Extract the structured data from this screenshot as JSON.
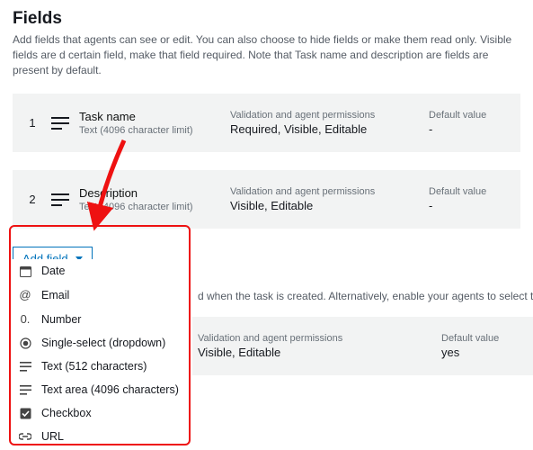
{
  "header": {
    "title": "Fields",
    "help": "Add fields that agents can see or edit. You can also choose to hide fields or make them read only. Visible fields are d certain field, make that field required. Note that Task name and description are fields are present by default."
  },
  "labels": {
    "validation": "Validation and agent permissions",
    "default": "Default value"
  },
  "fields": [
    {
      "num": "1",
      "name": "Task name",
      "sub": "Text (4096 character limit)",
      "validation": "Required, Visible, Editable",
      "default": "-"
    },
    {
      "num": "2",
      "name": "Description",
      "sub": "Text (4096 character limit)",
      "validation": "Visible, Editable",
      "default": "-"
    }
  ],
  "add_field_label": "Add field",
  "dropdown": [
    {
      "icon": "calendar",
      "label": "Date"
    },
    {
      "icon": "at",
      "label": "Email"
    },
    {
      "icon": "zero",
      "label": "Number"
    },
    {
      "icon": "radio",
      "label": "Single-select (dropdown)"
    },
    {
      "icon": "text",
      "label": "Text (512 characters)"
    },
    {
      "icon": "text",
      "label": "Text area (4096 characters)"
    },
    {
      "icon": "check",
      "label": "Checkbox"
    },
    {
      "icon": "link",
      "label": "URL"
    }
  ],
  "section2": {
    "help_frag": "d when the task is created. Alternatively, enable your agents to select the Qu"
  },
  "field3": {
    "validation_label": "Validation and agent permissions",
    "validation": "Visible, Editable",
    "default_label": "Default value",
    "default": "yes"
  }
}
